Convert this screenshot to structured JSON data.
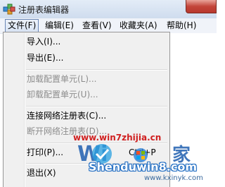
{
  "window": {
    "title": "注册表编辑器"
  },
  "menubar": {
    "items": [
      {
        "label": "文件(F)"
      },
      {
        "label": "编辑(E)"
      },
      {
        "label": "查看(V)"
      },
      {
        "label": "收藏夹(A)"
      },
      {
        "label": "帮助(H)"
      }
    ]
  },
  "file_menu": {
    "import": "导入(I)...",
    "export": "导出(E)...",
    "load_hive": "加载配置单元(L)...",
    "unload_hive": "卸载配置单元(U)...",
    "connect": "连接网络注册表(C)...",
    "disconnect": "断开网络注册表(D)...",
    "print": "打印(P)...",
    "print_shortcut": "Ctrl+P",
    "exit": "退出(X)"
  },
  "watermark": {
    "url": "www.win7zhijia.cn",
    "brand": "Shenduwin8.com",
    "site": "www.kxinyk.com"
  }
}
